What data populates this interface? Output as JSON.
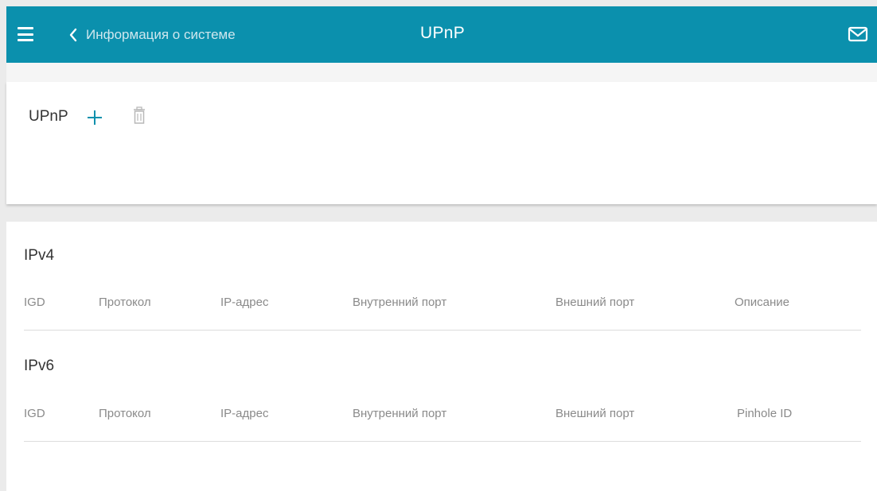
{
  "header": {
    "back_label": "Информация о системе",
    "title": "UPnP",
    "menu_icon": "hamburger-icon",
    "mail_icon": "mail-icon",
    "color": "#0b90ad"
  },
  "upnp_section": {
    "title": "UPnP",
    "add_icon": "plus-icon",
    "delete_icon": "trash-icon"
  },
  "ipv4": {
    "title": "IPv4",
    "columns": [
      "IGD",
      "Протокол",
      "IP-адрес",
      "Внутренний порт",
      "Внешний порт",
      "Описание"
    ]
  },
  "ipv6": {
    "title": "IPv6",
    "columns": [
      "IGD",
      "Протокол",
      "IP-адрес",
      "Внутренний порт",
      "Внешний порт",
      "Pinhole ID"
    ]
  }
}
